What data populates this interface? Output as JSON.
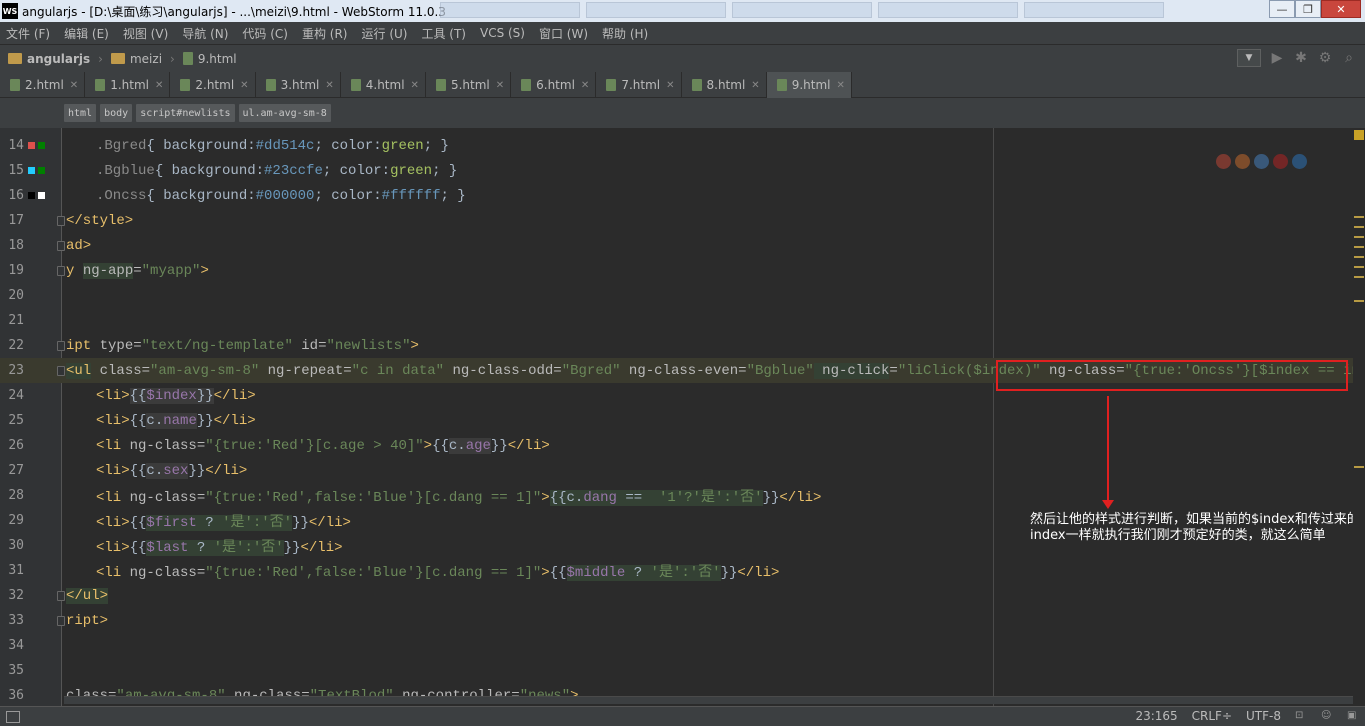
{
  "window": {
    "title": "angularjs - [D:\\桌面\\练习\\angularjs] - ...\\meizi\\9.html - WebStorm 11.0.3",
    "app_icon": "WS",
    "controls": [
      "minimize",
      "maximize",
      "close"
    ]
  },
  "menu": {
    "items": [
      "文件 (F)",
      "编辑 (E)",
      "视图 (V)",
      "导航 (N)",
      "代码 (C)",
      "重构 (R)",
      "运行 (U)",
      "工具 (T)",
      "VCS (S)",
      "窗口 (W)",
      "帮助 (H)"
    ]
  },
  "navbar": {
    "project": "angularjs",
    "folder": "meizi",
    "file": "9.html"
  },
  "tabs": [
    {
      "label": "2.html",
      "active": false
    },
    {
      "label": "1.html",
      "active": false
    },
    {
      "label": "2.html",
      "active": false
    },
    {
      "label": "3.html",
      "active": false
    },
    {
      "label": "4.html",
      "active": false
    },
    {
      "label": "5.html",
      "active": false
    },
    {
      "label": "6.html",
      "active": false
    },
    {
      "label": "7.html",
      "active": false
    },
    {
      "label": "8.html",
      "active": false
    },
    {
      "label": "9.html",
      "active": true
    }
  ],
  "breadcrumbs": [
    "html",
    "body",
    "script#newlists",
    "ul.am-avg-sm-8"
  ],
  "editor": {
    "line_numbers": [
      "14",
      "15",
      "16",
      "17",
      "18",
      "19",
      "20",
      "21",
      "22",
      "23",
      "24",
      "25",
      "26",
      "27",
      "28",
      "29",
      "30",
      "31",
      "32",
      "33",
      "34",
      "35",
      "36"
    ],
    "swatch_colors": {
      "14": "#dd514c",
      "15": "#23ccfe",
      "16": "#000000",
      "16b": "#ffffff",
      "green": "#008000"
    },
    "code": {
      "l14a": ".Bgred",
      "l14b": "{ background:",
      "l14c": "#dd514c",
      "l14d": "; color:",
      "l14e": "green",
      "l14f": "; }",
      "l15a": ".Bgblue",
      "l15b": "{ background:",
      "l15c": "#23ccfe",
      "l15d": "; color:",
      "l15e": "green",
      "l15f": "; }",
      "l16a": ".Oncss",
      "l16b": "{ background:",
      "l16c": "#000000",
      "l16d": "; color:",
      "l16e": "#ffffff",
      "l16f": "; }",
      "l17": "</style>",
      "l18": "ad>",
      "l19a": "y ",
      "l19b": "ng-app",
      "l19c": "=",
      "l19d": "\"myapp\"",
      "l19e": ">",
      "l22a": "ipt ",
      "l22b": "type=",
      "l22c": "\"text/ng-template\"",
      "l22d": " id=",
      "l22e": "\"newlists\"",
      "l22f": ">",
      "l23a": "<ul",
      "l23b": " class=",
      "l23c": "\"am-avg-sm-8\"",
      "l23d": " ng-repeat=",
      "l23e": "\"c in data\"",
      "l23f": " ng-class-odd=",
      "l23g": "\"Bgred\"",
      "l23h": " ng-class-even=",
      "l23i": "\"Bgblue\"",
      "l23j": " ng-click",
      "l23k": "=",
      "l23l": "\"liClick($index)\"",
      "l23m": " ng-class=",
      "l23n": "\"{true:'Oncss'}[$index == index]\"",
      "l23o": " >",
      "l24a": "<li>",
      "l24b": "{{",
      "l24c": "$index",
      "l24d": "}}",
      "l24e": "</li>",
      "l25a": "<li>",
      "l25b": "{{",
      "l25c": "c.",
      "l25d": "name",
      "l25e": "}}",
      "l25f": "</li>",
      "l26a": "<li",
      "l26b": " ng-class=",
      "l26c": "\"{true:'Red'}[c.age > 40]\"",
      "l26d": ">",
      "l26e": "{{",
      "l26f": "c.",
      "l26g": "age",
      "l26h": "}}",
      "l26i": "</li>",
      "l27a": "<li>",
      "l27b": "{{",
      "l27c": "c.",
      "l27d": "sex",
      "l27e": "}}",
      "l27f": "</li>",
      "l28a": "<li",
      "l28b": " ng-class=",
      "l28c": "\"{true:'Red',false:'Blue'}[c.dang == 1]\"",
      "l28d": ">",
      "l28e": "{{",
      "l28f": "c.",
      "l28g": "dang",
      "l28h": " ==  ",
      "l28i": "'1'?'是':'否'",
      "l28j": "}}",
      "l28k": "</li>",
      "l29a": "<li>",
      "l29b": "{{",
      "l29c": "$first",
      "l29d": " ? ",
      "l29e": "'是':'否'",
      "l29f": "}}",
      "l29g": "</li>",
      "l30a": "<li>",
      "l30b": "{{",
      "l30c": "$last",
      "l30d": " ? ",
      "l30e": "'是':'否'",
      "l30f": "}}",
      "l30g": "</li>",
      "l31a": "<li",
      "l31b": " ng-class=",
      "l31c": "\"{true:'Red',false:'Blue'}[c.dang == 1]\"",
      "l31d": ">",
      "l31e": "{{",
      "l31f": "$middle",
      "l31g": " ? ",
      "l31h": "'是':'否'",
      "l31i": "}}",
      "l31j": "</li>",
      "l32": "</ul>",
      "l33": "ript>",
      "l36a": "class=",
      "l36b": "\"am-avg-sm-8\"",
      "l36c": " ng-class=",
      "l36d": "\"TextBlod\"",
      "l36e": " ng-controller=",
      "l36f": "\"news\"",
      "l36g": ">"
    }
  },
  "annotation": {
    "note": "然后让他的样式进行判断，如果当前的$index和传过来的index一样就执行我们刚才预定好的类，就这么简单",
    "box_color": "#e02020"
  },
  "status": {
    "position": "23:165",
    "line_ending": "CRLF÷",
    "encoding": "UTF-8"
  }
}
